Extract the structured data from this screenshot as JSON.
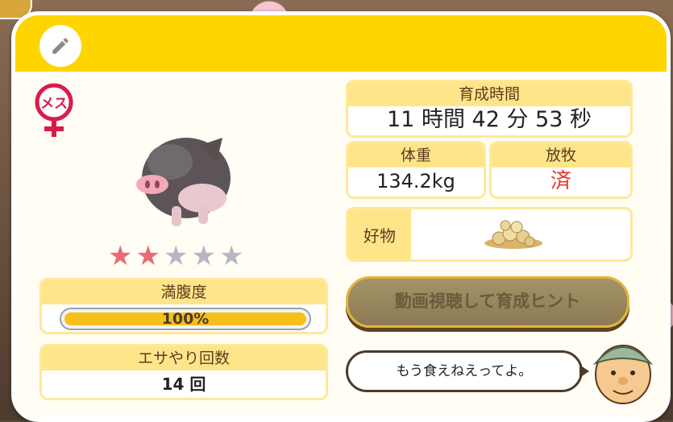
{
  "header": {
    "edit_icon": "pencil-icon"
  },
  "gender": {
    "label": "メス",
    "icon": "female-symbol-icon",
    "color": "#d81b4a"
  },
  "rating": {
    "filled": 2,
    "total": 5
  },
  "fullness": {
    "title": "満腹度",
    "value_text": "100%",
    "fill_fraction": 1.0
  },
  "feed_count": {
    "title": "エサやり回数",
    "value": "14 回"
  },
  "raise_time": {
    "title": "育成時間",
    "value": "11 時間 42 分 53 秒"
  },
  "weight": {
    "title": "体重",
    "value": "134.2kg"
  },
  "grazing": {
    "title": "放牧",
    "value": "済"
  },
  "favorite": {
    "title": "好物",
    "icon": "grain-pile-icon"
  },
  "hint_button": {
    "label": "動画視聴して育成ヒント"
  },
  "speech": {
    "text": "もう食えねえってよ。"
  },
  "colors": {
    "header": "#ffd500",
    "accent_star": "#e96b73",
    "inactive_star": "#b6b7c2",
    "grazing_text": "#e4352c"
  }
}
